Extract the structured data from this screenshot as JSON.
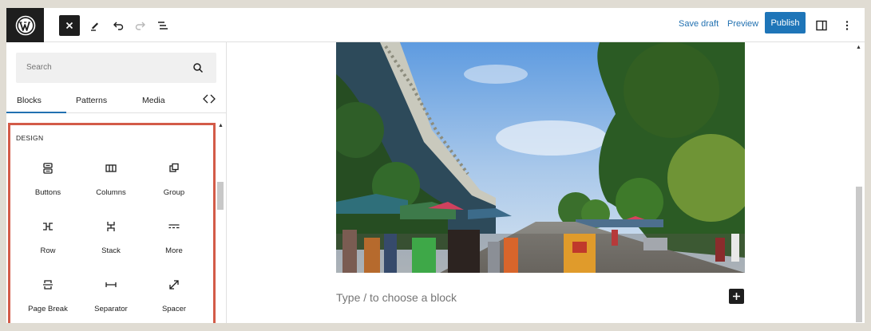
{
  "toolbar": {
    "save_draft": "Save draft",
    "preview": "Preview",
    "publish": "Publish",
    "icons": [
      "wordpress-logo",
      "close-icon",
      "pencil-icon",
      "undo-icon",
      "redo-icon",
      "list-view-icon",
      "sidebar-toggle-icon",
      "more-options-icon"
    ]
  },
  "inserter": {
    "search_placeholder": "Search",
    "tabs": [
      "Blocks",
      "Patterns",
      "Media"
    ],
    "active_tab": "Blocks",
    "category": "DESIGN",
    "blocks": [
      {
        "label": "Buttons",
        "icon": "buttons-icon"
      },
      {
        "label": "Columns",
        "icon": "columns-icon"
      },
      {
        "label": "Group",
        "icon": "group-icon"
      },
      {
        "label": "Row",
        "icon": "row-icon"
      },
      {
        "label": "Stack",
        "icon": "stack-icon"
      },
      {
        "label": "More",
        "icon": "more-icon"
      },
      {
        "label": "Page Break",
        "icon": "page-break-icon"
      },
      {
        "label": "Separator",
        "icon": "separator-icon"
      },
      {
        "label": "Spacer",
        "icon": "spacer-icon"
      }
    ]
  },
  "editor": {
    "placeholder": "Type / to choose a block"
  },
  "colors": {
    "accent": "#2271b1",
    "publish_bg": "#1e75b8",
    "highlight": "#d35b48",
    "dark": "#1e1e1e"
  }
}
